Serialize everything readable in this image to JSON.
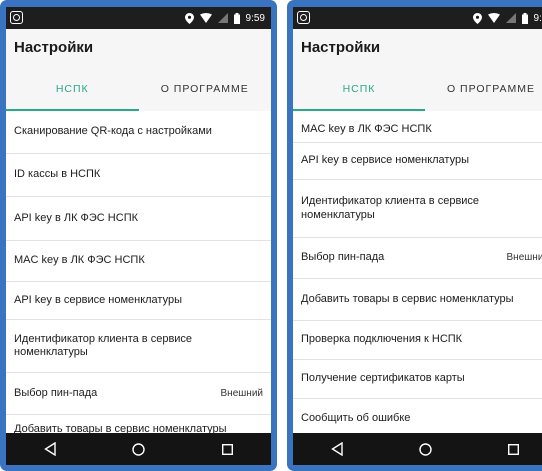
{
  "statusbar": {
    "time": "9:59"
  },
  "appbar": {
    "title": "Настройки"
  },
  "tabs": [
    {
      "label": "НСПК",
      "active": true
    },
    {
      "label": "О ПРОГРАММЕ",
      "active": false
    }
  ],
  "left_list": [
    {
      "label": "Сканирование QR-кода с настройками",
      "value": ""
    },
    {
      "label": "ID кассы в НСПК",
      "value": ""
    },
    {
      "label": "API key в ЛК ФЭС НСПК",
      "value": ""
    },
    {
      "label": "MAC key в ЛК ФЭС НСПК",
      "value": ""
    },
    {
      "label": "API key в сервисе номенклатуры",
      "value": ""
    },
    {
      "label": "Идентификатор клиента в сервисе номенклатуры",
      "value": ""
    },
    {
      "label": "Выбор пин-пада",
      "value": "Внешний"
    },
    {
      "label": "Добавить товары в сервис номенклатуры",
      "value": ""
    }
  ],
  "right_list": [
    {
      "label": "MAC key в ЛК ФЭС НСПК",
      "value": ""
    },
    {
      "label": "API key в сервисе номенклатуры",
      "value": ""
    },
    {
      "label": "Идентификатор клиента в сервисе номенклатуры",
      "value": ""
    },
    {
      "label": "Выбор пин-пада",
      "value": "Внешний"
    },
    {
      "label": "Добавить товары в сервис номенклатуры",
      "value": ""
    },
    {
      "label": "Проверка подключения к НСПК",
      "value": ""
    },
    {
      "label": "Получение сертификатов карты",
      "value": ""
    },
    {
      "label": "Сообщить об ошибке",
      "value": ""
    }
  ],
  "colors": {
    "accent": "#2aa889",
    "frame": "#3a73bf",
    "statusbar": "#1e1e1e",
    "navbar": "#141414",
    "appbar": "#f6f6f6"
  },
  "icons": {
    "app": "app-icon",
    "location": "location-icon",
    "wifi": "wifi-icon",
    "signal": "signal-icon",
    "battery": "battery-icon",
    "back": "back-icon",
    "home": "home-icon",
    "recents": "recents-icon"
  }
}
